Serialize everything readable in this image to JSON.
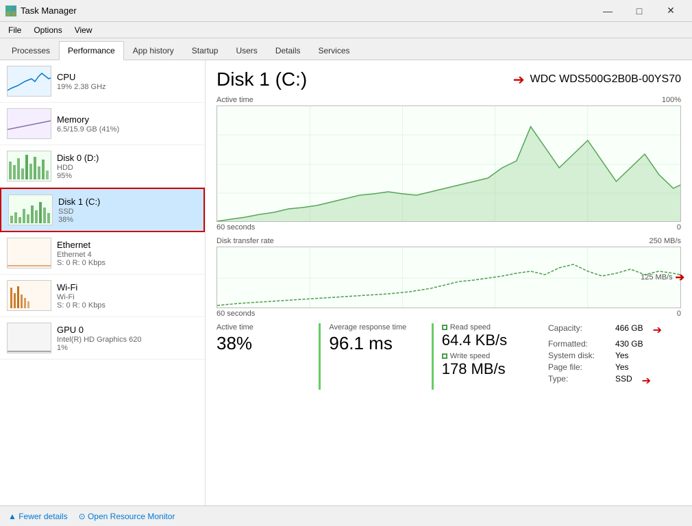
{
  "titleBar": {
    "title": "Task Manager",
    "minimize": "—",
    "maximize": "□",
    "close": "✕"
  },
  "menuBar": {
    "items": [
      "File",
      "Options",
      "View"
    ]
  },
  "tabs": {
    "items": [
      "Processes",
      "Performance",
      "App history",
      "Startup",
      "Users",
      "Details",
      "Services"
    ],
    "active": "Performance"
  },
  "sidebar": {
    "items": [
      {
        "id": "cpu",
        "name": "CPU",
        "sub1": "19%  2.38 GHz",
        "sub2": "",
        "color": "#0078d4"
      },
      {
        "id": "memory",
        "name": "Memory",
        "sub1": "6.5/15.9 GB (41%)",
        "sub2": "",
        "color": "#8b6fa8"
      },
      {
        "id": "disk0",
        "name": "Disk 0 (D:)",
        "sub1": "HDD",
        "sub2": "95%",
        "color": "#4da04d"
      },
      {
        "id": "disk1",
        "name": "Disk 1 (C:)",
        "sub1": "SSD",
        "sub2": "38%",
        "color": "#4da04d",
        "active": true
      },
      {
        "id": "ethernet",
        "name": "Ethernet",
        "sub1": "Ethernet 4",
        "sub2": "S: 0 R: 0 Kbps",
        "color": "#c06000"
      },
      {
        "id": "wifi",
        "name": "Wi-Fi",
        "sub1": "Wi-Fi",
        "sub2": "S: 0 R: 0 Kbps",
        "color": "#c06000"
      },
      {
        "id": "gpu",
        "name": "GPU 0",
        "sub1": "Intel(R) HD Graphics 620",
        "sub2": "1%",
        "color": "#555"
      }
    ]
  },
  "content": {
    "diskTitle": "Disk 1 (C:)",
    "diskModel": "WDC WDS500G2B0B-00YS70",
    "activeTimeLabel": "Active time",
    "activeTimePct": "100%",
    "chartSeconds": "60 seconds",
    "chartZero": "0",
    "transferRateLabel": "Disk transfer rate",
    "transferRateMax": "250 MB/s",
    "transferRateMid": "125 MB/s",
    "transferSeconds": "60 seconds",
    "transferZero": "0",
    "stats": {
      "activeTimeLabel": "Active time",
      "activeTimeValue": "38%",
      "responseTimeLabel": "Average response time",
      "responseTimeValue": "96.1 ms",
      "readSpeedLabel": "Read speed",
      "readSpeedValue": "64.4 KB/s",
      "writeSpeedLabel": "Write speed",
      "writeSpeedValue": "178 MB/s"
    },
    "info": {
      "capacityLabel": "Capacity:",
      "capacityValue": "466 GB",
      "formattedLabel": "Formatted:",
      "formattedValue": "430 GB",
      "systemDiskLabel": "System disk:",
      "systemDiskValue": "Yes",
      "pageFileLabel": "Page file:",
      "pageFileValue": "Yes",
      "typeLabel": "Type:",
      "typeValue": "SSD"
    }
  },
  "bottomBar": {
    "fewerDetails": "▲ Fewer details",
    "openResourceMonitor": "⊙ Open Resource Monitor"
  }
}
